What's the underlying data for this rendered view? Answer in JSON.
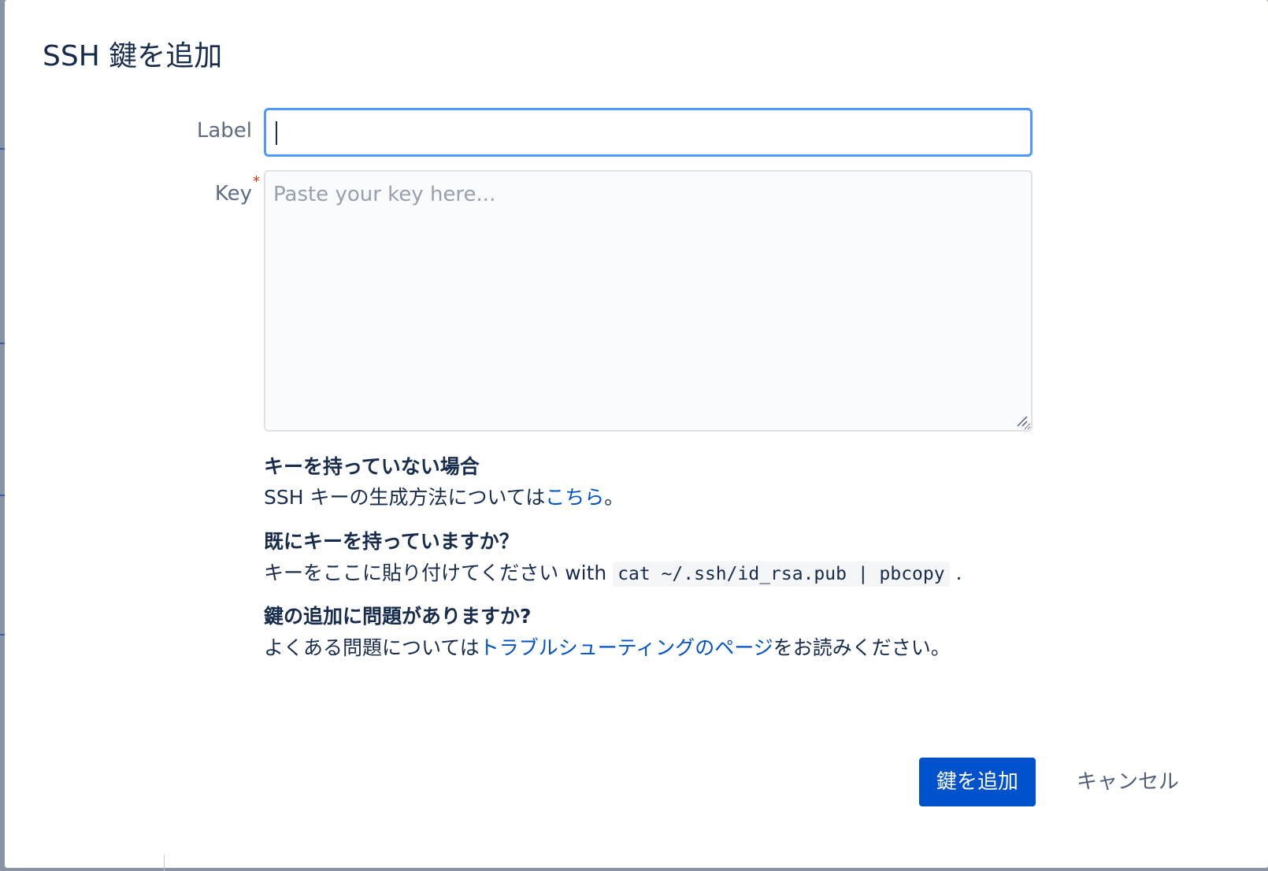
{
  "dialog": {
    "title": "SSH 鍵を追加"
  },
  "form": {
    "label_field": {
      "label": "Label",
      "value": ""
    },
    "key_field": {
      "label": "Key",
      "required_marker": "*",
      "placeholder": "Paste your key here..."
    }
  },
  "help": {
    "no_key": {
      "heading": "キーを持っていない場合",
      "text_before": "SSH キーの生成方法については",
      "link_text": "こちら",
      "text_after": "。"
    },
    "have_key": {
      "heading": "既にキーを持っていますか？",
      "text_before": "キーをここに貼り付けてください with ",
      "command": "cat ~/.ssh/id_rsa.pub | pbcopy",
      "text_after": " ."
    },
    "problem": {
      "heading": "鍵の追加に問題がありますか?",
      "text_before": "よくある問題については",
      "link_text": "トラブルシューティングのページ",
      "text_after": "をお読みください。"
    }
  },
  "actions": {
    "submit_label": "鍵を追加",
    "cancel_label": "キャンセル"
  },
  "colors": {
    "primary": "#0052cc",
    "focus_ring": "#4c9aff",
    "required": "#de350b",
    "text": "#172b4d"
  },
  "icons": {
    "resize_handle": "resize-handle-icon"
  }
}
